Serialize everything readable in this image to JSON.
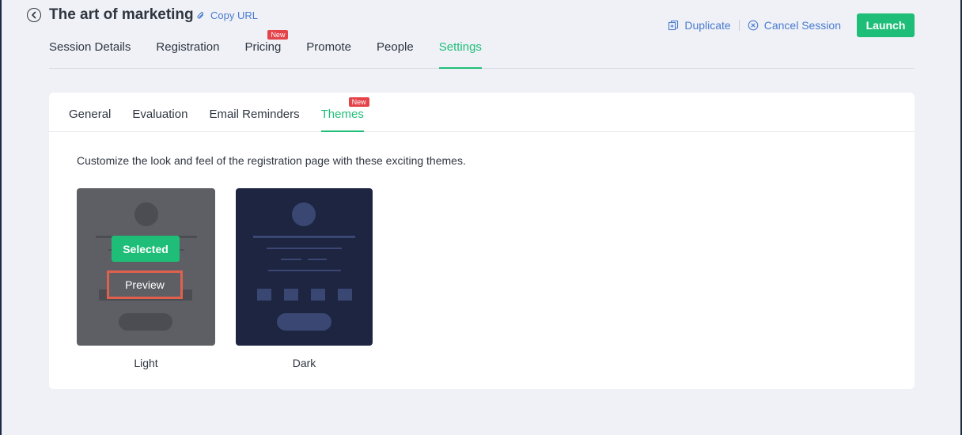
{
  "header": {
    "title": "The art of marketing",
    "copy_url": "Copy URL",
    "duplicate": "Duplicate",
    "cancel_session": "Cancel Session",
    "launch": "Launch"
  },
  "main_tabs": [
    {
      "label": "Session Details"
    },
    {
      "label": "Registration"
    },
    {
      "label": "Pricing",
      "badge": "New"
    },
    {
      "label": "Promote"
    },
    {
      "label": "People"
    },
    {
      "label": "Settings",
      "active": true
    }
  ],
  "sub_tabs": [
    {
      "label": "General"
    },
    {
      "label": "Evaluation"
    },
    {
      "label": "Email Reminders"
    },
    {
      "label": "Themes",
      "badge": "New",
      "active": true
    }
  ],
  "themes": {
    "description": "Customize the look and feel of the registration page with these exciting themes.",
    "items": [
      {
        "label": "Light",
        "selected_label": "Selected",
        "preview_label": "Preview"
      },
      {
        "label": "Dark"
      }
    ]
  },
  "colors": {
    "accent": "#1fbe78",
    "link": "#4a7bd0",
    "badge": "#e5434a",
    "highlight": "#e0604e"
  }
}
